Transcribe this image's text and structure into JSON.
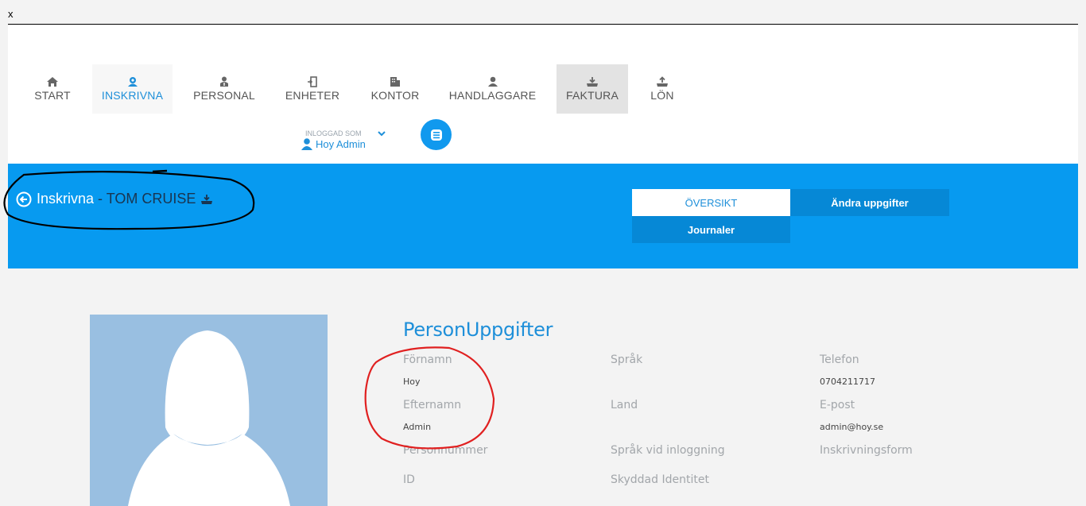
{
  "window": {
    "close_label": "x"
  },
  "nav": {
    "items": [
      {
        "label": "START",
        "icon": "home-icon"
      },
      {
        "label": "INSKRIVNA",
        "icon": "users-icon"
      },
      {
        "label": "PERSONAL",
        "icon": "staff-icon"
      },
      {
        "label": "ENHETER",
        "icon": "door-icon"
      },
      {
        "label": "KONTOR",
        "icon": "building-icon"
      },
      {
        "label": "HANDLAGGARE",
        "icon": "user-icon"
      },
      {
        "label": "FAKTURA",
        "icon": "tray-download-icon"
      },
      {
        "label": "LÖN",
        "icon": "tray-upload-icon"
      }
    ],
    "active_color": "#1e8fd9"
  },
  "login": {
    "caption": "INLOGGAD SOM",
    "user": "Hoy Admin"
  },
  "header": {
    "section": "Inskrivna",
    "person": "- TOM CRUISE",
    "band_color": "#079af0"
  },
  "tabs": {
    "oversikt": "ÖVERSIKT",
    "andra": "Ändra uppgifter",
    "journaler": "Journaler"
  },
  "person": {
    "title": "PersonUppgifter",
    "fornamn_label": "Förnamn",
    "fornamn_value": "Hoy",
    "efternamn_label": "Efternamn",
    "efternamn_value": "Admin",
    "personnummer_label": "Personnummer",
    "id_label": "ID",
    "sprak_label": "Språk",
    "land_label": "Land",
    "sprak_login_label": "Språk vid inloggning",
    "skyddad_label": "Skyddad Identitet",
    "telefon_label": "Telefon",
    "telefon_value": "0704211717",
    "epost_label": "E-post",
    "epost_value": "admin@hoy.se",
    "inskrivningsform_label": "Inskrivningsform"
  }
}
